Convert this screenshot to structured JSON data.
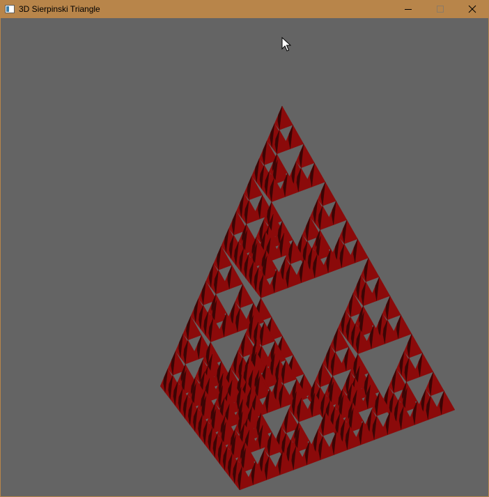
{
  "window": {
    "title": "3D Sierpinski Triangle",
    "frame_color": "#b8854a",
    "background_color": "#646464"
  },
  "controls": {
    "minimize_icon": "minimize-icon",
    "maximize_icon": "maximize-icon",
    "close_icon": "close-icon"
  },
  "scene": {
    "fractal_color": "#8b0a0a",
    "shade_color": "#3a0505"
  }
}
